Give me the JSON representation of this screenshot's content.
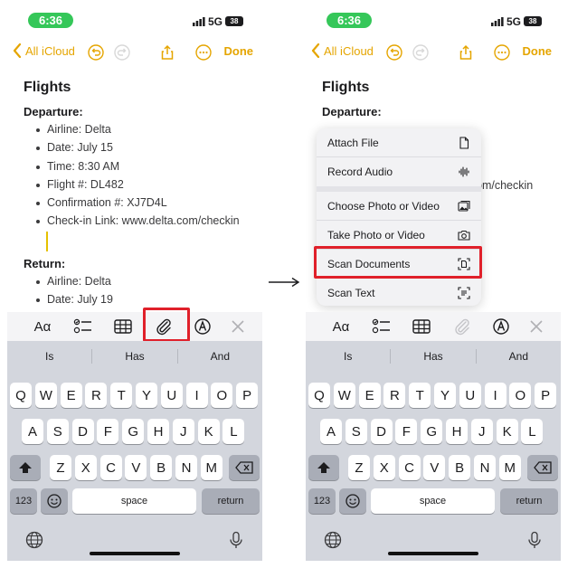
{
  "status": {
    "time": "6:36",
    "network": "5G",
    "battery": "38"
  },
  "nav": {
    "back_label": "All iCloud",
    "done_label": "Done"
  },
  "note": {
    "title": "Flights",
    "departure_heading": "Departure:",
    "departure_items": [
      "Airline: Delta",
      "Date: July 15",
      "Time: 8:30 AM",
      "Flight #: DL482",
      "Confirmation #: XJ7D4L",
      "Check-in Link: www.delta.com/checkin"
    ],
    "return_heading": "Return:",
    "return_items": [
      "Airline: Delta",
      "Date: July 19"
    ],
    "right_visible_fragment": "om/checkin"
  },
  "format_bar": {
    "text_style_label": "Aα"
  },
  "keyboard": {
    "suggestions": [
      "Is",
      "Has",
      "And"
    ],
    "row1": [
      "Q",
      "W",
      "E",
      "R",
      "T",
      "Y",
      "U",
      "I",
      "O",
      "P"
    ],
    "row2": [
      "A",
      "S",
      "D",
      "F",
      "G",
      "H",
      "J",
      "K",
      "L"
    ],
    "row3": [
      "Z",
      "X",
      "C",
      "V",
      "B",
      "N",
      "M"
    ],
    "numbers_label": "123",
    "space_label": "space",
    "return_label": "return"
  },
  "attach_menu": {
    "items": [
      {
        "label": "Attach File",
        "icon": "doc-icon"
      },
      {
        "label": "Record Audio",
        "icon": "waveform-icon"
      },
      {
        "label": "Choose Photo or Video",
        "icon": "photos-icon"
      },
      {
        "label": "Take Photo or Video",
        "icon": "camera-icon"
      },
      {
        "label": "Scan Documents",
        "icon": "doc-scan-icon"
      },
      {
        "label": "Scan Text",
        "icon": "text-scan-icon"
      }
    ]
  },
  "colors": {
    "accent": "#e5a500",
    "status_green": "#35c759",
    "highlight_red": "#e0202a"
  }
}
